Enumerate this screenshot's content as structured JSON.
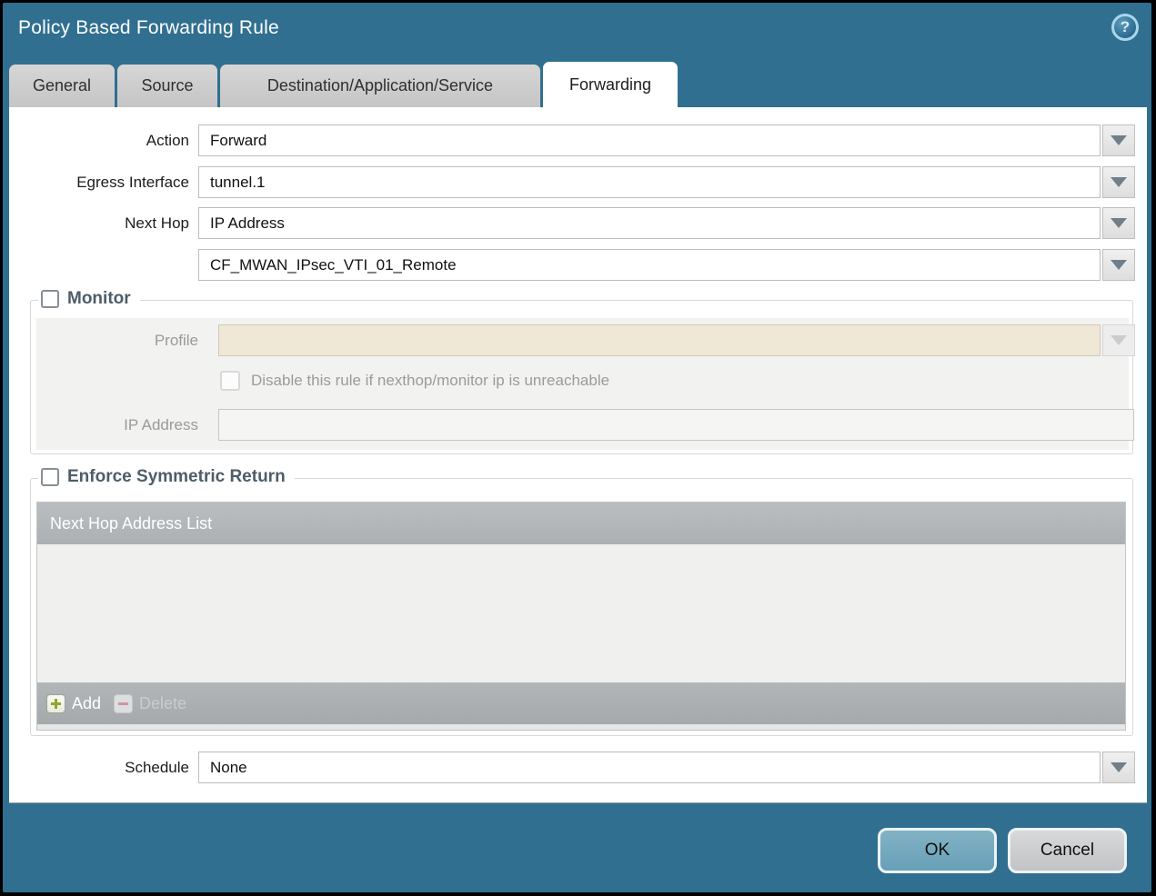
{
  "window": {
    "title": "Policy Based Forwarding Rule",
    "help_icon": "?"
  },
  "tabs": {
    "items": [
      {
        "label": "General",
        "active": false
      },
      {
        "label": "Source",
        "active": false
      },
      {
        "label": "Destination/Application/Service",
        "active": false
      },
      {
        "label": "Forwarding",
        "active": true
      }
    ]
  },
  "form": {
    "action_label": "Action",
    "action_value": "Forward",
    "egress_label": "Egress Interface",
    "egress_value": "tunnel.1",
    "next_hop_label": "Next Hop",
    "next_hop_value": "IP Address",
    "next_hop_address_value": "CF_MWAN_IPsec_VTI_01_Remote",
    "schedule_label": "Schedule",
    "schedule_value": "None"
  },
  "monitor": {
    "legend": "Monitor",
    "checked": false,
    "profile_label": "Profile",
    "profile_value": "",
    "disable_label": "Disable this rule if nexthop/monitor ip is unreachable",
    "disable_checked": false,
    "ip_label": "IP Address",
    "ip_value": ""
  },
  "symmetric": {
    "legend": "Enforce Symmetric Return",
    "checked": false,
    "table_header": "Next Hop Address List",
    "rows": [],
    "add_label": "Add",
    "delete_label": "Delete"
  },
  "buttons": {
    "ok": "OK",
    "cancel": "Cancel"
  },
  "colors": {
    "chrome_blue": "#306f90",
    "ok_button": "#6fa6bd",
    "disabled_field_beige": "#f0e8d6",
    "legend_text": "#4e5d68",
    "table_header_gray": "#b2b6b9",
    "toolbar_gray": "#abafb2",
    "add_plus_green": "#93a42e",
    "delete_minus_red": "#d493a0"
  }
}
